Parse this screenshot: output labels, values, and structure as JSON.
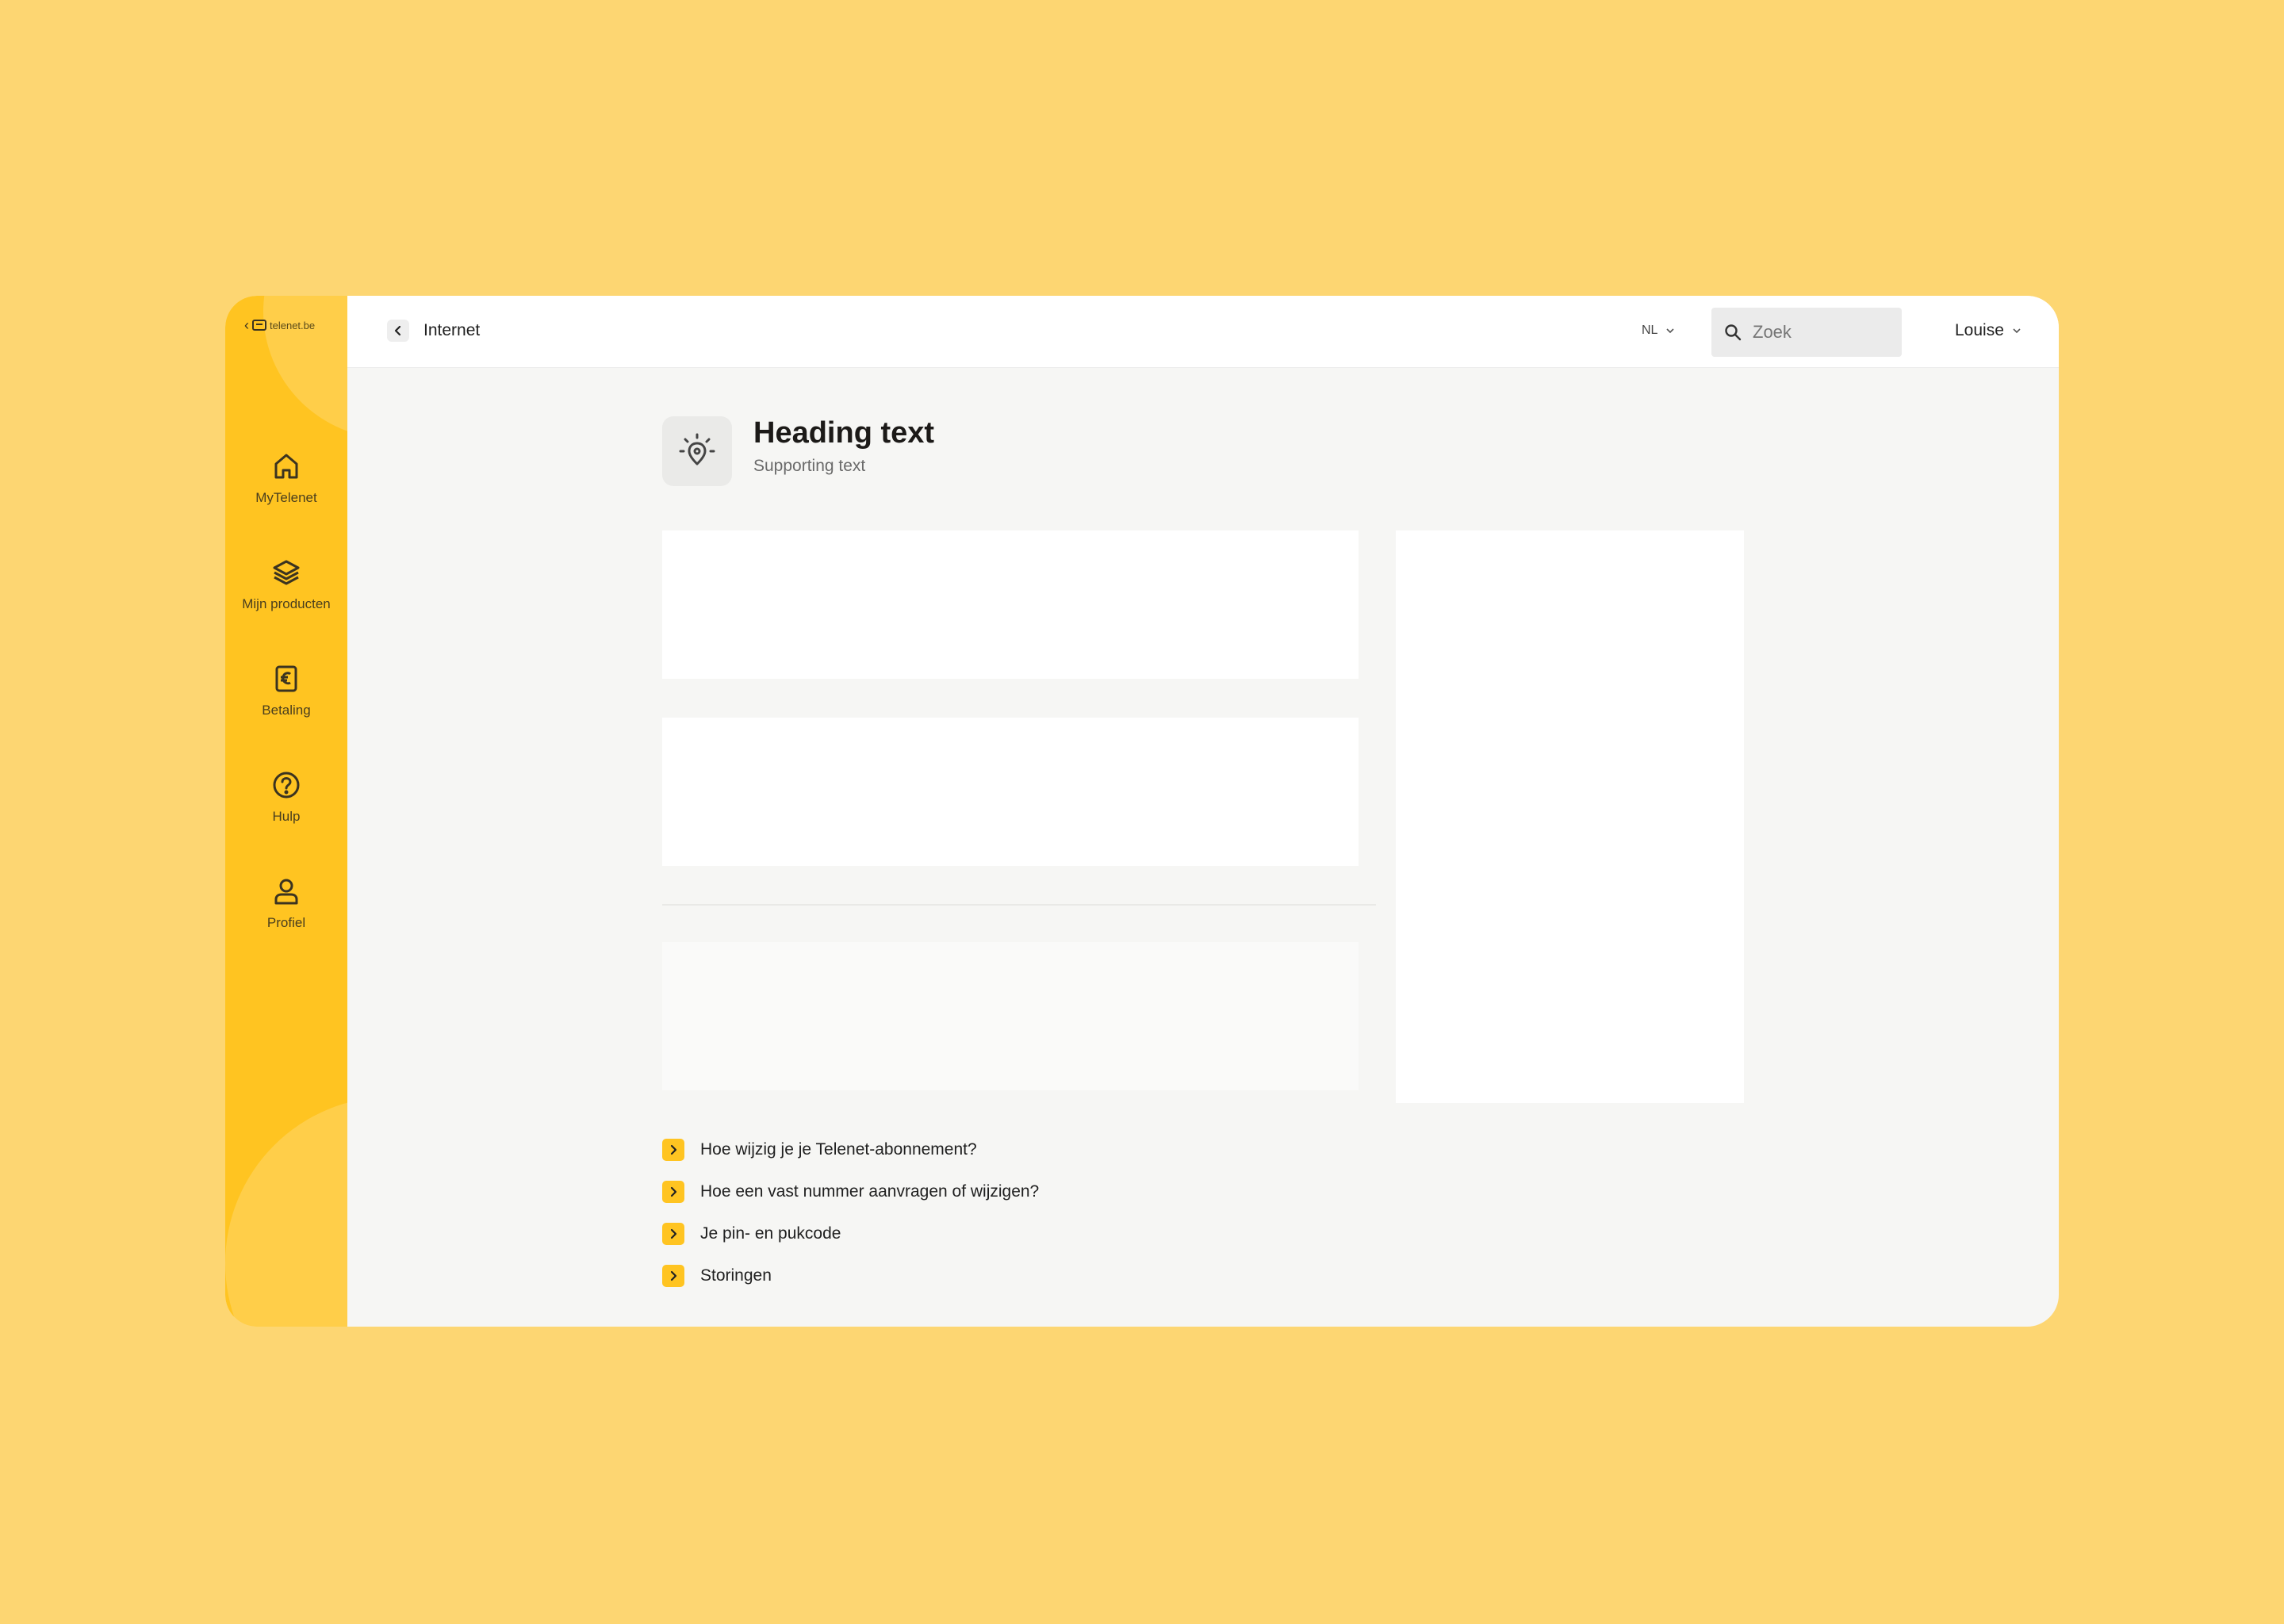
{
  "colors": {
    "page_background": "#FDD672",
    "sidebar": "#FFC421",
    "accent": "#FFC421",
    "content_background": "#F6F6F4"
  },
  "brand": {
    "back_icon": "chevron-left-icon",
    "logo_icon": "tv-icon",
    "text": "telenet.be"
  },
  "sidebar": {
    "items": [
      {
        "label": "MyTelenet",
        "icon": "home-icon"
      },
      {
        "label": "Mijn producten",
        "icon": "layers-icon"
      },
      {
        "label": "Betaling",
        "icon": "euro-invoice-icon"
      },
      {
        "label": "Hulp",
        "icon": "help-circle-icon"
      },
      {
        "label": "Profiel",
        "icon": "user-icon"
      }
    ]
  },
  "header": {
    "back_icon": "chevron-left-icon",
    "page_title": "Internet",
    "language": "NL",
    "search_placeholder": "Zoek",
    "user_name": "Louise"
  },
  "main": {
    "icon": "lightbulb-location-icon",
    "heading": "Heading text",
    "subheading": "Supporting text"
  },
  "faq": {
    "items": [
      {
        "label": "Hoe wijzig je je Telenet-abonnement?"
      },
      {
        "label": "Hoe een vast nummer aanvragen of wijzigen?"
      },
      {
        "label": "Je pin- en pukcode"
      },
      {
        "label": "Storingen"
      }
    ]
  }
}
